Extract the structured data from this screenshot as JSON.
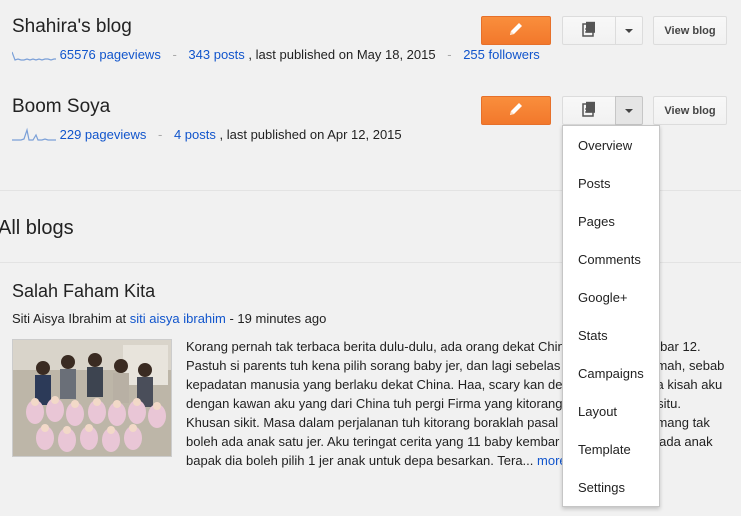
{
  "blogs": [
    {
      "title": "Shahira's blog",
      "pageviews": "65576 pageviews",
      "posts": "343 posts",
      "published": ", last published on May 18, 2015",
      "followers": "255 followers",
      "view_label": "View blog"
    },
    {
      "title": "Boom Soya",
      "pageviews": "229 pageviews",
      "posts": "4 posts",
      "published": ", last published on Apr 12, 2015",
      "view_label": "View blog"
    }
  ],
  "all_blogs": {
    "heading": "All blogs"
  },
  "post": {
    "title": "Salah Faham Kita",
    "author": "Siti Aisya Ibrahim",
    "at": " at ",
    "blog_link": "siti aisya ibrahim",
    "time": " - 19 minutes ago",
    "snippet": "Korang pernah tak terbaca berita dulu-dulu, ada orang dekat China lahir anak kembar 12. Pastuh si parents tuh kena pilih sorang baby jer, dan lagi sebelas kena bagi kat rumah, sebab kepadatan manusia yang berlaku dekat China. Haa, scary kan dengar? Ini pun ada kisah aku dengan kawan aku yang dari China tuh pergi Firma yang kitorang nak pratikal kat situ. Khusan sikit. Masa dalam perjalanan tuh kitorang boraklah pasal dekat China, memang tak boleh ada anak satu jer. Aku teringat cerita yang 11 baby kembar terpaksa diberi pada anak bapak dia boleh pilih 1 jer anak untuk depa besarkan. Tera...",
    "more": "more »"
  },
  "menu": {
    "items": [
      "Overview",
      "Posts",
      "Pages",
      "Comments",
      "Google+",
      "Stats",
      "Campaigns",
      "Layout",
      "Template",
      "Settings"
    ]
  },
  "icons": {
    "edit": "pencil-icon",
    "posts": "document-list-icon",
    "dropdown": "chevron-down-icon",
    "sparkline": "pageviews-sparkline-icon"
  },
  "colors": {
    "accent_orange": "#f2782c",
    "link_blue": "#1155cc",
    "background": "#f1f1f1"
  }
}
